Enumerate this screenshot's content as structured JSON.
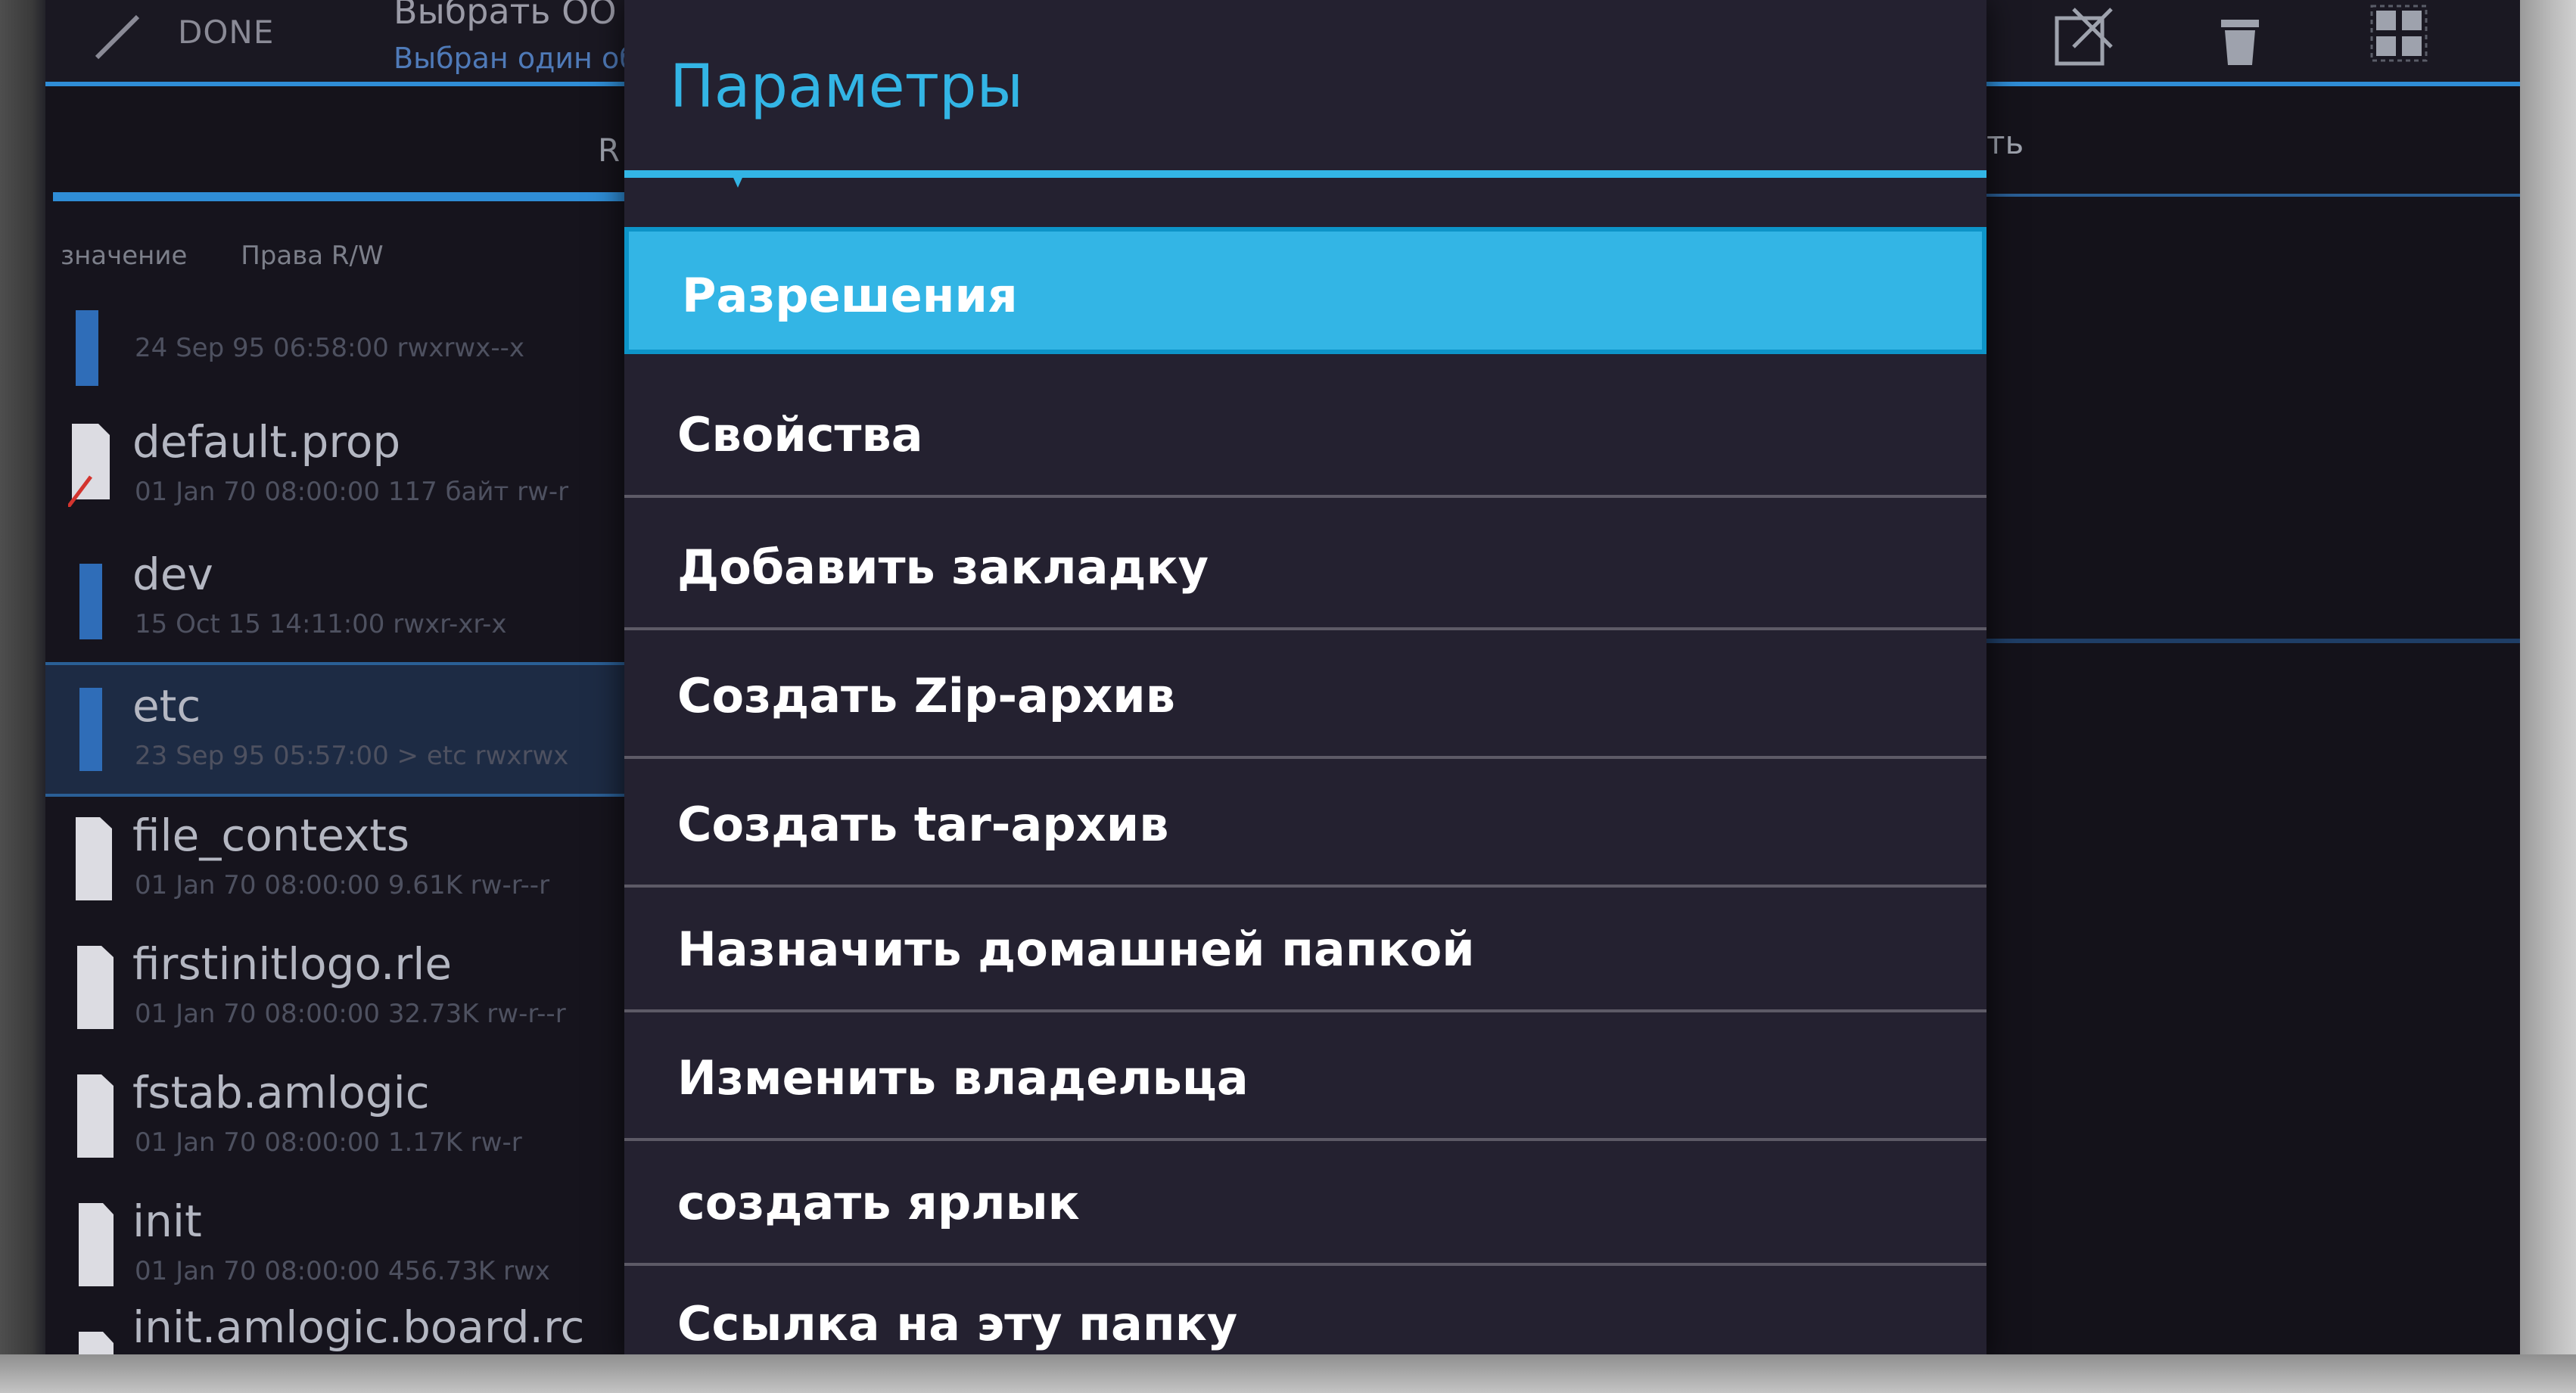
{
  "actionbar": {
    "done_label": "DONE",
    "title": "Выбрать ОО Б",
    "subtitle": "Выбран один объ"
  },
  "tabs": {
    "left_label": "R",
    "right_label": "ть"
  },
  "columns": {
    "col1": "значение",
    "col2": "Права R/W"
  },
  "files": [
    {
      "name": "",
      "meta": "24 Sep 95 06:58:00   rwxrwx--x"
    },
    {
      "name": "default.prop",
      "meta": "01 Jan 70 08:00:00  117 байт  rw-r"
    },
    {
      "name": "dev",
      "meta": "15 Oct 15 14:11:00   rwxr-xr-x"
    },
    {
      "name": "etc",
      "meta": "23 Sep 95 05:57:00  > etc  rwxrwx"
    },
    {
      "name": "file_contexts",
      "meta": "01 Jan 70 08:00:00  9.61K  rw-r--r"
    },
    {
      "name": "firstinitlogo.rle",
      "meta": "01 Jan 70 08:00:00  32.73K  rw-r--r"
    },
    {
      "name": "fstab.amlogic",
      "meta": "01 Jan 70 08:00:00  1.17K  rw-r"
    },
    {
      "name": "init",
      "meta": "01 Jan 70 08:00:00  456.73K  rwx"
    },
    {
      "name": "init.amlogic.board.rc",
      "meta": ""
    }
  ],
  "dialog": {
    "title": "Параметры",
    "items": [
      "Разрешения",
      "Свойства",
      "Добавить закладку",
      "Создать Zip-архив",
      "Создать tar-архив",
      "Назначить домашней папкой",
      "Изменить владельца",
      "создать ярлык",
      "Ссылка на эту папку"
    ]
  },
  "colors": {
    "accent": "#33b5e5",
    "selection_border": "#0d94c8",
    "dialog_bg": "#242130"
  }
}
